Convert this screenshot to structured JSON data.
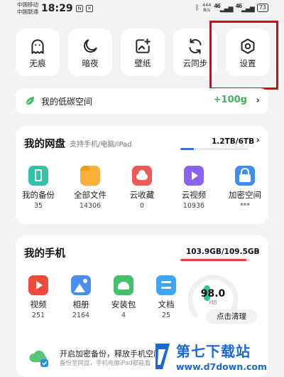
{
  "status_bar": {
    "carrier1": "中国移动",
    "carrier2": "中国联通",
    "time": "18:29",
    "speed_top": "444",
    "speed_bottom": "B/s",
    "signal1": "46",
    "signal2": "46",
    "battery": "73"
  },
  "quick_actions": [
    {
      "label": "无痕",
      "icon": "ghost-icon"
    },
    {
      "label": "暗夜",
      "icon": "moon-icon"
    },
    {
      "label": "壁纸",
      "icon": "wallpaper-icon"
    },
    {
      "label": "云同步",
      "icon": "cloud-sync-icon"
    },
    {
      "label": "设置",
      "icon": "settings-icon"
    }
  ],
  "low_carbon": {
    "label": "我的低碳空间",
    "points": "+100g"
  },
  "cloud_drive": {
    "title": "我的网盘",
    "subtitle": "支持手机/电脑/iPad",
    "usage": "1.2TB/6TB",
    "usage_fraction": 0.2,
    "items": [
      {
        "label": "我的备份",
        "count": "35",
        "icon": "phone-backup-icon",
        "color": "#35c0a9"
      },
      {
        "label": "全部文件",
        "count": "14306",
        "icon": "folder-icon",
        "color": "#fbb03b"
      },
      {
        "label": "云收藏",
        "count": "0",
        "icon": "cloud-favorite-icon",
        "color": "#ef5a57"
      },
      {
        "label": "云视频",
        "count": "10936",
        "icon": "cloud-video-icon",
        "color": "#8b63f0"
      },
      {
        "label": "加密空间",
        "count": "***",
        "icon": "lock-icon",
        "color": "#3d8ef2"
      }
    ]
  },
  "my_phone": {
    "title": "我的手机",
    "storage": "103.9GB/109.5GB",
    "storage_fraction": 0.949,
    "items": [
      {
        "label": "视频",
        "count": "251",
        "icon": "video-icon",
        "color": "#ef4b3d"
      },
      {
        "label": "相册",
        "count": "2164",
        "icon": "photo-album-icon",
        "color": "#4a8ff0"
      },
      {
        "label": "安装包",
        "count": "4",
        "icon": "android-package-icon",
        "color": "#42c06a"
      },
      {
        "label": "文档",
        "count": "25",
        "icon": "document-icon",
        "color": "#3da7f3"
      }
    ],
    "cleanup_score": "98.0",
    "cleanup_unit": "MB",
    "cleanup_button": "点击清理"
  },
  "backup_banner": {
    "title": "开启加密备份，释放手机空间",
    "desc": "备份至网盘，手机电脑iPad都能看"
  },
  "watermark": {
    "title": "第七下载站",
    "url": "www.d7down.com"
  }
}
